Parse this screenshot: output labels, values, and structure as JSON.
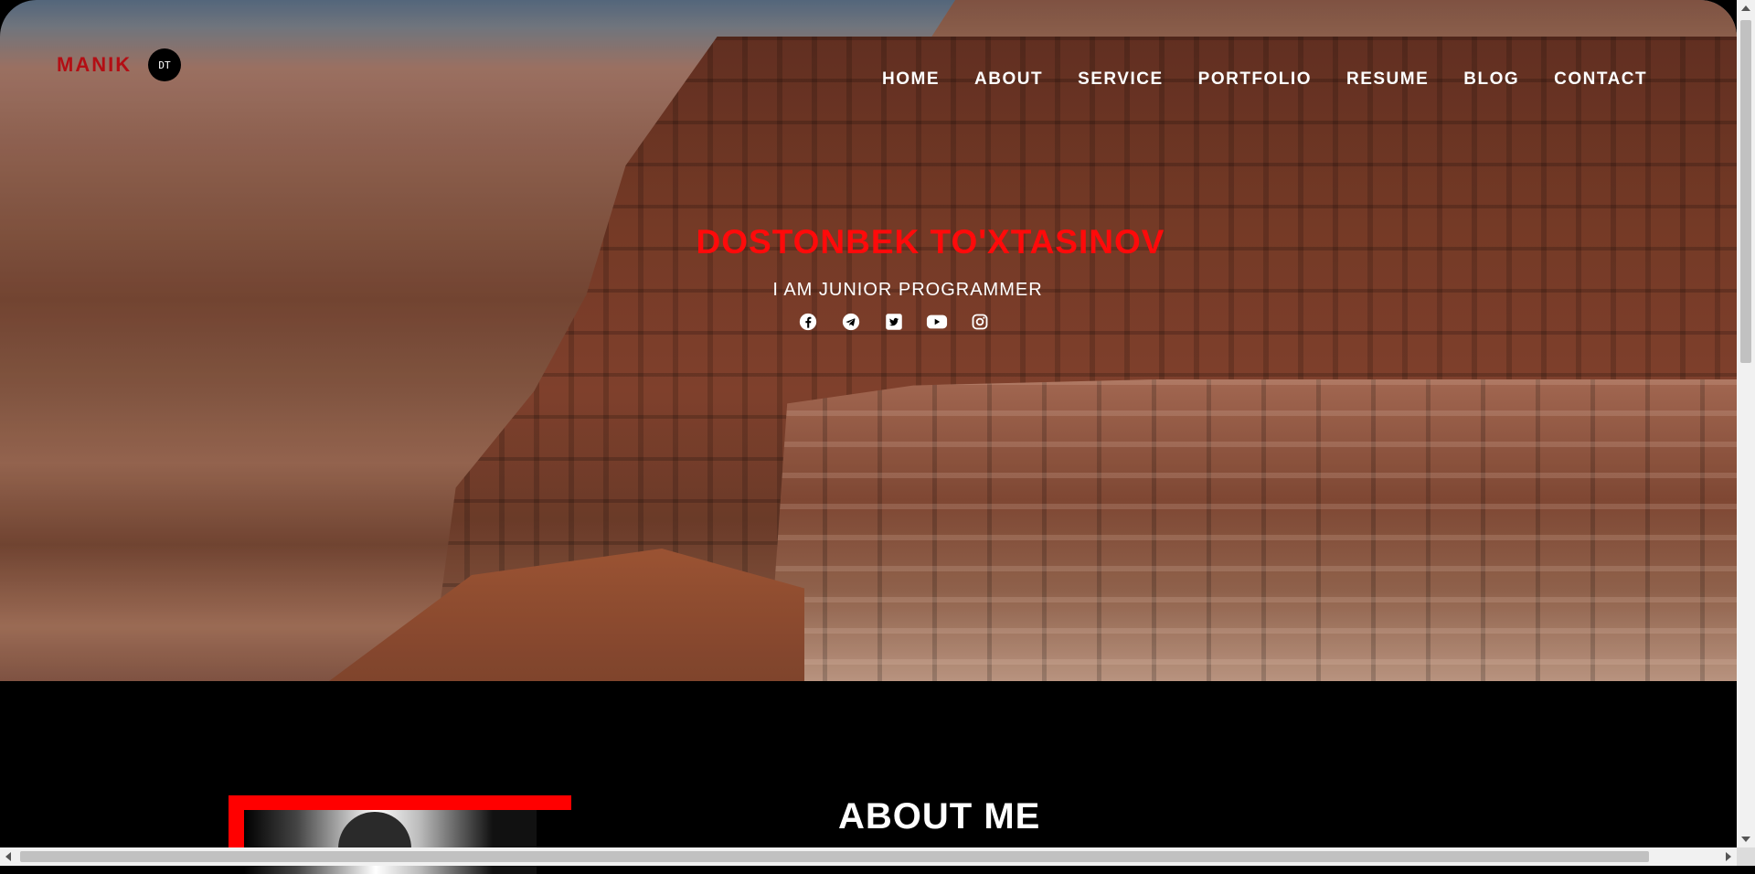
{
  "brand": {
    "name": "MANIK",
    "badge": "DT"
  },
  "nav": {
    "items": [
      {
        "label": "HOME"
      },
      {
        "label": "ABOUT"
      },
      {
        "label": "SERVICE"
      },
      {
        "label": "PORTFOLIO"
      },
      {
        "label": "RESUME"
      },
      {
        "label": "BLOG"
      },
      {
        "label": "CONTACT"
      }
    ]
  },
  "hero": {
    "title": "DOSTONBEK TO'XTASINOV",
    "subtitle": "I AM JUNIOR PROGRAMMER",
    "socials": [
      "facebook-icon",
      "telegram-icon",
      "twitter-icon",
      "youtube-icon",
      "instagram-icon"
    ]
  },
  "about": {
    "title": "ABOUT ME"
  },
  "colors": {
    "accent": "#ff0a0a",
    "brand": "#b30e14",
    "background": "#000000"
  }
}
